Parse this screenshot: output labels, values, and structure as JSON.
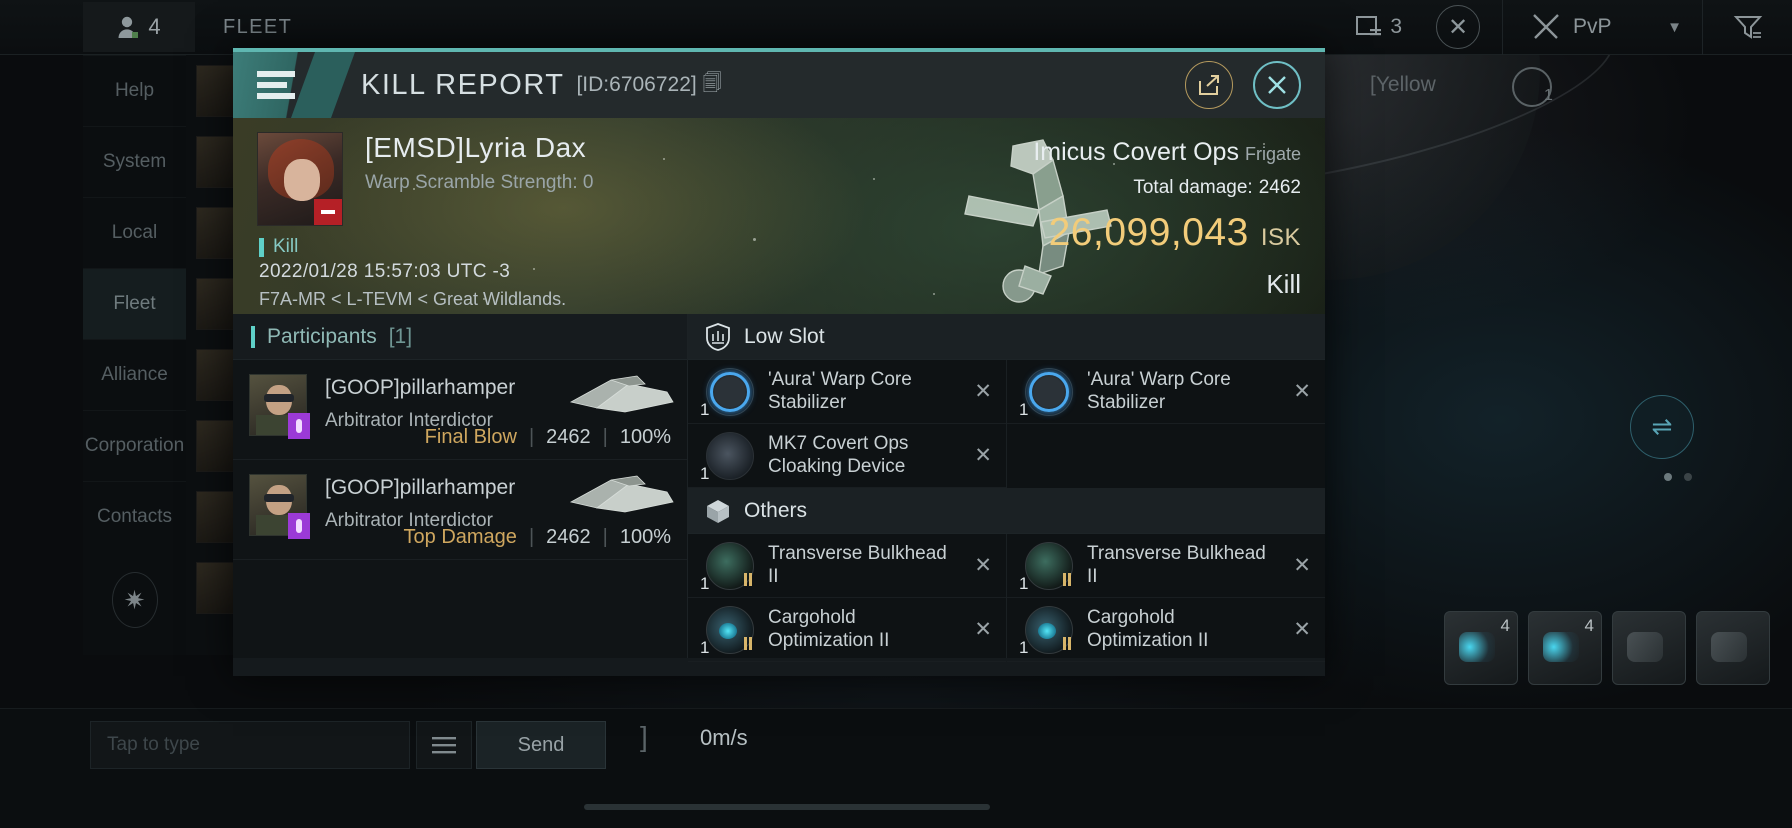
{
  "topbar": {
    "member_icon": "person-icon",
    "member_count": "4",
    "title": "FLEET",
    "window_icon": "window-icon",
    "window_count": "3",
    "close_icon": "close-icon",
    "pvp_icon": "crossed-swords-icon",
    "pvp_label": "PvP",
    "chevron_icon": "chevron-down-icon",
    "filter_icon": "filter-icon"
  },
  "sidebar": {
    "items": [
      {
        "label": "Help"
      },
      {
        "label": "System"
      },
      {
        "label": "Local"
      },
      {
        "label": "Fleet"
      },
      {
        "label": "Alliance"
      },
      {
        "label": "Corporation"
      },
      {
        "label": "Contacts"
      }
    ],
    "active_index": 3,
    "settings_icon": "gear-icon"
  },
  "right_hud": {
    "channel_tag": "[Yellow",
    "magnifier_icon": "magnifier-icon",
    "magnifier_count": "1",
    "swap_icon": "swap-arrows-icon",
    "module_counts": [
      "4",
      "4"
    ]
  },
  "bottom_bar": {
    "input_placeholder": "Tap to type",
    "input_value": "",
    "menu_icon": "list-icon",
    "send_label": "Send",
    "speed": "0m/s",
    "bracket": "]"
  },
  "modal": {
    "header": {
      "menu_icon": "hamburger-icon",
      "title": "KILL REPORT",
      "id_label": "[ID:6706722]",
      "copy_icon": "copy-icon",
      "share_icon": "share-external-icon",
      "close_icon": "close-x-icon"
    },
    "banner": {
      "avatar_icon": "victim-portrait",
      "victim_badge_icon": "minus-badge-icon",
      "victim_name": "[EMSD]Lyria Dax",
      "warp_scramble": "Warp Scramble Strength: 0",
      "result_label": "Kill",
      "timestamp": "2022/01/28 15:57:03 UTC -3",
      "location": "F7A-MR < L-TEVM < Great Wildlands.",
      "ship_art_icon": "destroyed-ship-icon",
      "ship_name": "Imicus Covert Ops",
      "ship_class": "Frigate",
      "total_damage_label": "Total damage:",
      "total_damage_value": "2462",
      "isk_value": "26,099,043",
      "isk_unit": "ISK",
      "outcome": "Kill"
    },
    "participants": {
      "title": "Participants",
      "count": "[1]",
      "rows": [
        {
          "avatar_icon": "pilot-portrait",
          "tag_icon": "security-tag-icon",
          "name": "[GOOP]pillarhamper",
          "ship": "Arbitrator Interdictor",
          "ship_art_icon": "arbitrator-ship-icon",
          "stat_label": "Final Blow",
          "damage": "2462",
          "percent": "100%"
        },
        {
          "avatar_icon": "pilot-portrait",
          "tag_icon": "security-tag-icon",
          "name": "[GOOP]pillarhamper",
          "ship": "Arbitrator Interdictor",
          "ship_art_icon": "arbitrator-ship-icon",
          "stat_label": "Top Damage",
          "damage": "2462",
          "percent": "100%"
        }
      ]
    },
    "fitting": {
      "sections": [
        {
          "icon": "low-slot-shield-icon",
          "title": "Low Slot",
          "columns": [
            [
              {
                "icon": "aura-warp-core-stabilizer-icon",
                "qty": "1",
                "name": "'Aura' Warp Core Stabilizer",
                "meta": "",
                "remove_icon": "x-icon"
              },
              {
                "icon": "mk7-covert-ops-cloaking-device-icon",
                "qty": "1",
                "name": "MK7 Covert Ops Cloaking Device",
                "meta": "",
                "remove_icon": "x-icon"
              }
            ],
            [
              {
                "icon": "aura-warp-core-stabilizer-icon",
                "qty": "1",
                "name": "'Aura' Warp Core Stabilizer",
                "meta": "",
                "remove_icon": "x-icon"
              }
            ]
          ]
        },
        {
          "icon": "others-box-icon",
          "title": "Others",
          "columns": [
            [
              {
                "icon": "transverse-bulkhead-icon",
                "qty": "1",
                "name": "Transverse Bulkhead II",
                "meta": "II",
                "remove_icon": "x-icon"
              },
              {
                "icon": "cargohold-optimization-icon",
                "qty": "1",
                "name": "Cargohold Optimization II",
                "meta": "II",
                "remove_icon": "x-icon"
              }
            ],
            [
              {
                "icon": "transverse-bulkhead-icon",
                "qty": "1",
                "name": "Transverse Bulkhead II",
                "meta": "II",
                "remove_icon": "x-icon"
              },
              {
                "icon": "cargohold-optimization-icon",
                "qty": "1",
                "name": "Cargohold Optimization II",
                "meta": "II",
                "remove_icon": "x-icon"
              }
            ]
          ]
        }
      ]
    }
  },
  "colors": {
    "accent_teal": "#5fd0c8",
    "isk_gold": "#f2cc7a",
    "stat_gold": "#cfa75f",
    "header_bg": "#242a2c"
  }
}
